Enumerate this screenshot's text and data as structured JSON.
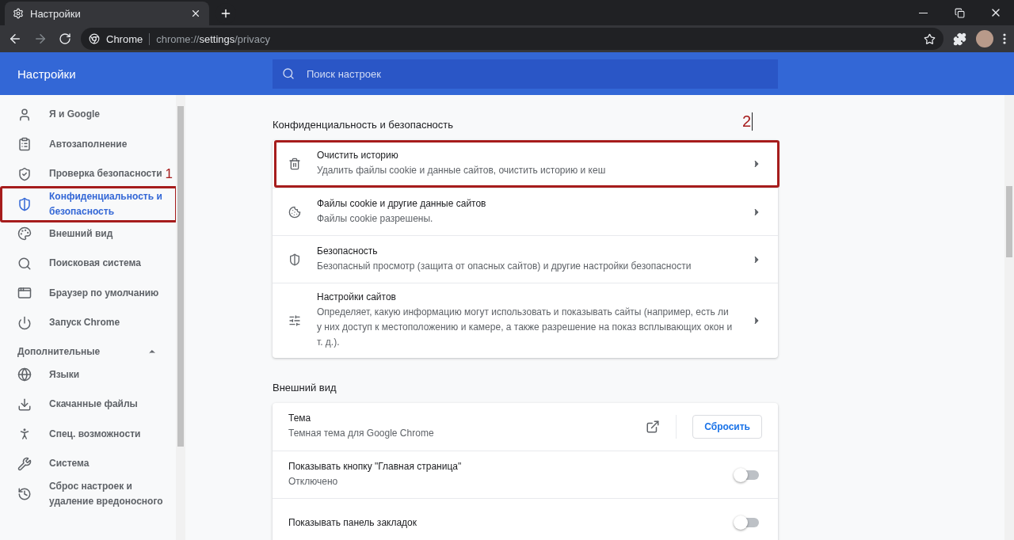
{
  "browser": {
    "tab": {
      "title": "Настройки"
    },
    "omnibox": {
      "site": "Chrome",
      "url_host": "chrome://",
      "url_path": "settings",
      "url_rest": "/privacy"
    }
  },
  "header": {
    "title": "Настройки",
    "search": {
      "placeholder": "Поиск настроек"
    }
  },
  "sidebar": {
    "items": [
      {
        "label": "Я и Google",
        "selected": false,
        "outlined": false
      },
      {
        "label": "Автозаполнение",
        "selected": false,
        "outlined": false
      },
      {
        "label": "Проверка безопасности",
        "selected": false,
        "outlined": false,
        "marker": "1"
      },
      {
        "label": "Конфиденциальность и безопасность",
        "selected": true,
        "outlined": true
      },
      {
        "label": "Внешний вид",
        "selected": false,
        "outlined": false
      },
      {
        "label": "Поисковая система",
        "selected": false,
        "outlined": false
      },
      {
        "label": "Браузер по умолчанию",
        "selected": false,
        "outlined": false
      },
      {
        "label": "Запуск Chrome",
        "selected": false,
        "outlined": false
      }
    ],
    "advanced": {
      "label": "Дополнительные",
      "expanded": true,
      "items": [
        {
          "label": "Языки",
          "selected": false,
          "outlined": false
        },
        {
          "label": "Скачанные файлы",
          "selected": false,
          "outlined": false
        },
        {
          "label": "Спец. возможности",
          "selected": false,
          "outlined": false
        },
        {
          "label": "Система",
          "selected": false,
          "outlined": false
        },
        {
          "label": "Сброс настроек и удаление вредоносного",
          "selected": false,
          "outlined": false
        }
      ]
    }
  },
  "sections": [
    {
      "title": "Конфиденциальность и безопасность",
      "marker": "2",
      "rows": [
        {
          "kind": "link",
          "title": "Очистить историю",
          "subtitle": "Удалить файлы cookie и данные сайтов, очистить историю и кеш",
          "outlined": true
        },
        {
          "kind": "link",
          "title": "Файлы cookie и другие данные сайтов",
          "subtitle": "Файлы cookie разрешены.",
          "outlined": false
        },
        {
          "kind": "link",
          "title": "Безопасность",
          "subtitle": "Безопасный просмотр (защита от опасных сайтов) и другие настройки безопасности",
          "outlined": false
        },
        {
          "kind": "link",
          "title": "Настройки сайтов",
          "subtitle": "Определяет, какую информацию могут использовать и показывать сайты (например, есть ли у них доступ к местоположению и камере, а также разрешение на показ всплывающих окон и т. д.).",
          "outlined": false
        }
      ]
    },
    {
      "title": "Внешний вид",
      "rows": [
        {
          "kind": "theme",
          "title": "Тема",
          "subtitle": "Темная тема для Google Chrome",
          "button": "Сбросить",
          "outlined": false
        },
        {
          "kind": "toggle",
          "title": "Показывать кнопку \"Главная страница\"",
          "subtitle": "Отключено",
          "on": false,
          "outlined": false
        },
        {
          "kind": "toggle",
          "title": "Показывать панель закладок",
          "on": false,
          "outlined": false
        }
      ]
    }
  ]
}
